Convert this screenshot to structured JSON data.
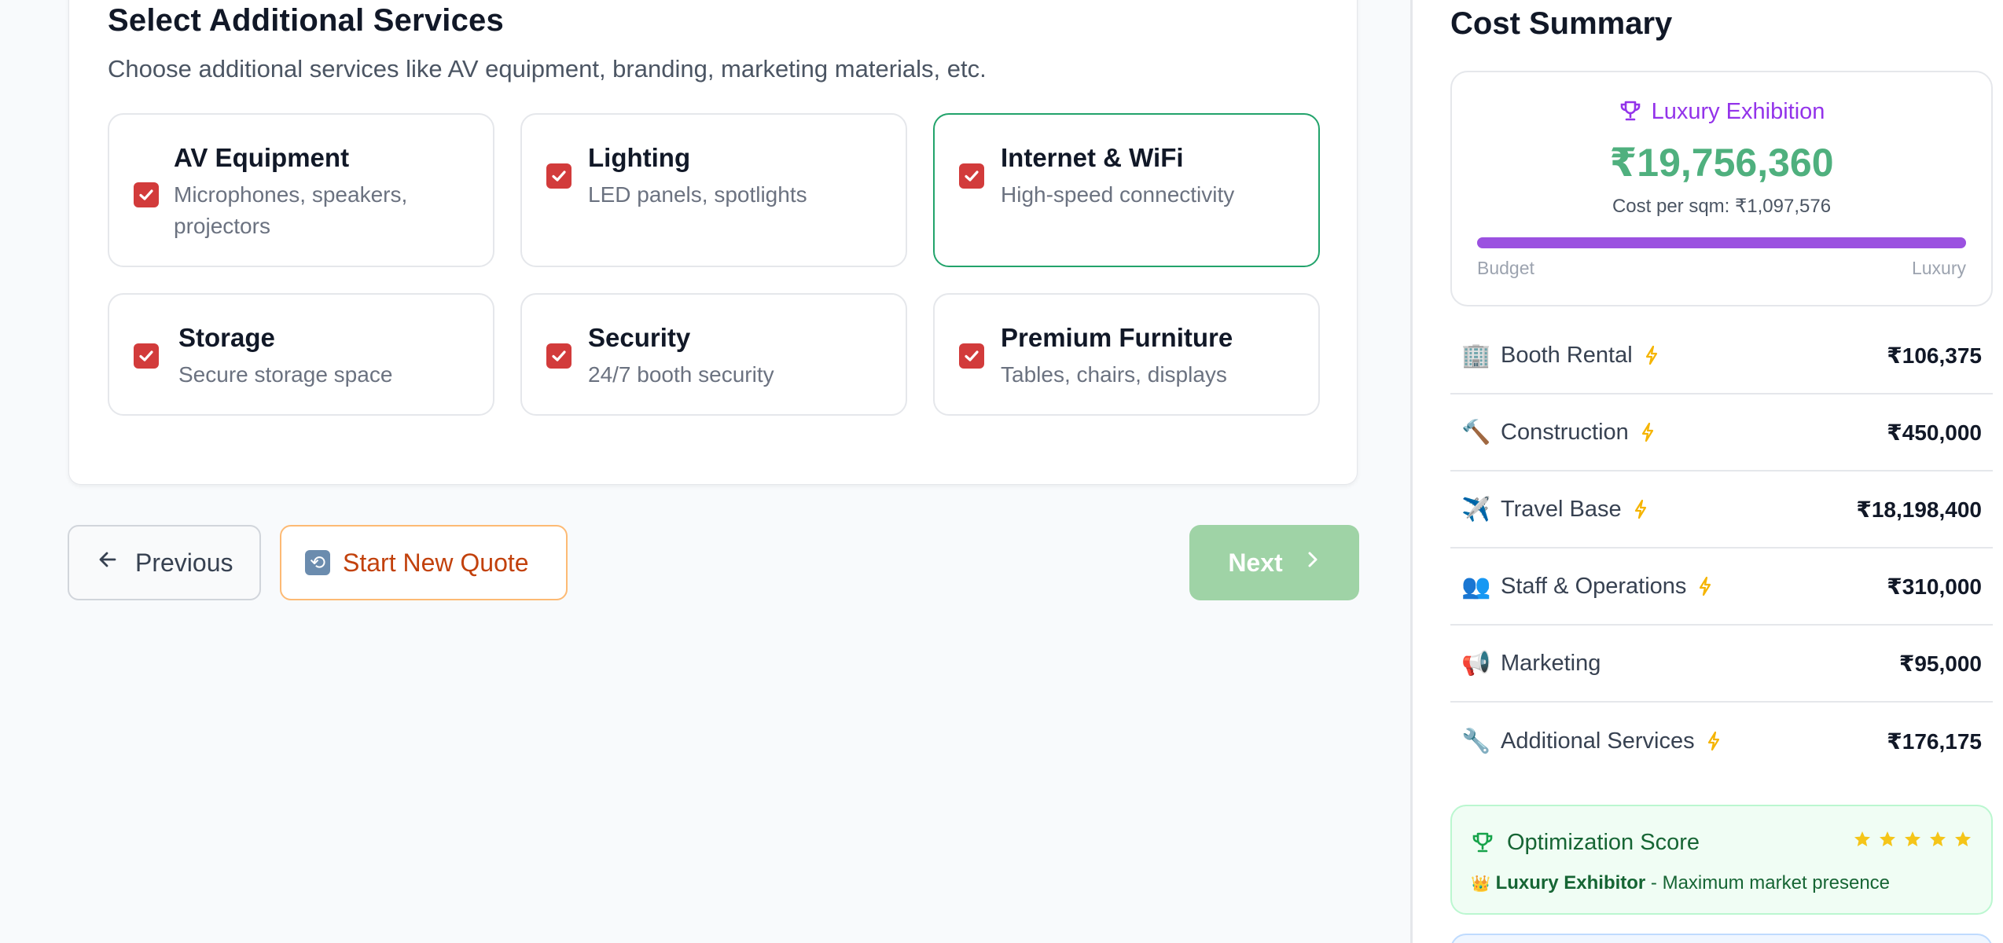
{
  "services": {
    "title": "Select Additional Services",
    "description": "Choose additional services like AV equipment, branding, marketing materials, etc.",
    "items": [
      {
        "name": "AV Equipment",
        "desc": "Microphones, speakers, projectors",
        "checked": true
      },
      {
        "name": "Lighting",
        "desc": "LED panels, spotlights",
        "checked": true
      },
      {
        "name": "Internet & WiFi",
        "desc": "High-speed connectivity",
        "checked": true
      },
      {
        "name": "Storage",
        "desc": "Secure storage space",
        "checked": true
      },
      {
        "name": "Security",
        "desc": "24/7 booth security",
        "checked": true
      },
      {
        "name": "Premium Furniture",
        "desc": "Tables, chairs, displays",
        "checked": true
      }
    ]
  },
  "nav": {
    "previous": "Previous",
    "start_new": "Start New Quote",
    "next": "Next"
  },
  "summary": {
    "title": "Cost Summary",
    "tier": "Luxury Exhibition",
    "total": "₹19,756,360",
    "per_sqm": "Cost per sqm: ₹1,097,576",
    "scale_min": "Budget",
    "scale_max": "Luxury",
    "scale_level": 1.0,
    "items": [
      {
        "icon": "🏢",
        "label": "Booth Rental",
        "amount": "₹106,375",
        "bolt": true
      },
      {
        "icon": "🔨",
        "label": "Construction",
        "amount": "₹450,000",
        "bolt": true
      },
      {
        "icon": "✈️",
        "label": "Travel Base",
        "amount": "₹18,198,400",
        "bolt": true
      },
      {
        "icon": "👥",
        "label": "Staff & Operations",
        "amount": "₹310,000",
        "bolt": true
      },
      {
        "icon": "📢",
        "label": "Marketing",
        "amount": "₹95,000",
        "bolt": false
      },
      {
        "icon": "🔧",
        "label": "Additional Services",
        "amount": "₹176,175",
        "bolt": true
      }
    ]
  },
  "optimization": {
    "title": "Optimization Score",
    "stars": 5,
    "crown": "👑",
    "badge": "Luxury Exhibitor",
    "detail": " - Maximum market presence"
  },
  "colors": {
    "accent_purple": "#9333ea",
    "total_green": "#4fb07e",
    "checkbox_red": "#d23b3b",
    "selected_border": "#22a36b",
    "star_yellow": "#f5c518",
    "bolt_yellow": "#f5b400"
  }
}
